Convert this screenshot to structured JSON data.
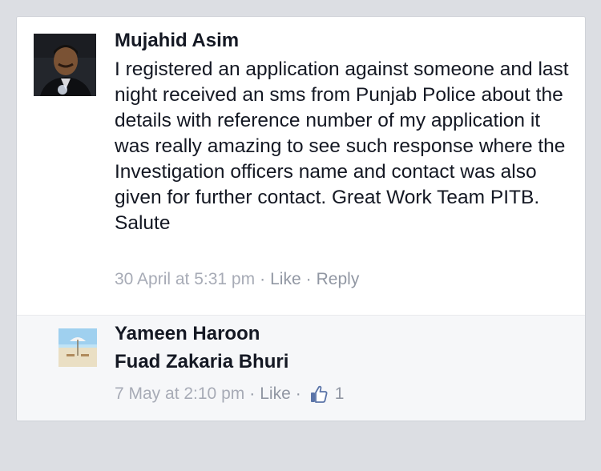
{
  "comment": {
    "author": "Mujahid Asim",
    "text": "I registered an application against someone and last night received an sms from Punjab Police about the details with reference number of my application it was really amazing to see such response where the Investigation officers name and contact was also given for further contact. Great Work Team PITB. Salute",
    "timestamp": "30 April at 5:31 pm",
    "separator": "·",
    "like_label": "Like",
    "reply_label": "Reply"
  },
  "reply": {
    "author": "Yameen Haroon",
    "tagged_name": "Fuad Zakaria Bhuri",
    "timestamp": "7 May at 2:10 pm",
    "separator": "·",
    "like_label": "Like",
    "like_icon": "thumbs-up-icon",
    "like_count": "1"
  },
  "colors": {
    "text": "#141823",
    "meta": "#9197a3",
    "like_icon": "#5b74a8",
    "reply_bg": "#f6f7f9",
    "page_bg": "#dcdee3"
  }
}
